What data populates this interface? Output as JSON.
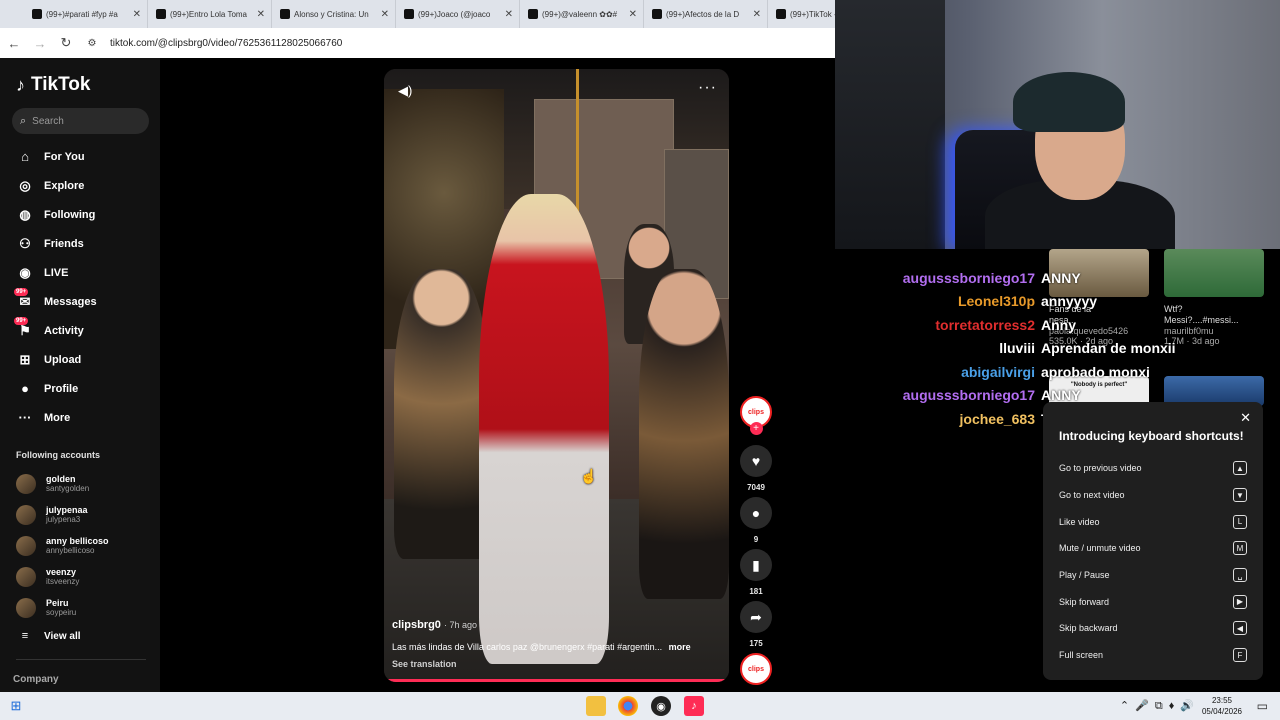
{
  "browser": {
    "tabs": [
      {
        "title": "(99+)#parati #fyp #a"
      },
      {
        "title": "(99+)Entro Lola Toma"
      },
      {
        "title": "Alonso y Cristina: Un"
      },
      {
        "title": "(99+)Joaco (@joaco"
      },
      {
        "title": "(99+)@valeenn ✿✿#"
      },
      {
        "title": "(99+)Afectos de la D"
      },
      {
        "title": "(99+)TikTok -"
      }
    ],
    "url": "tiktok.com/@clipsbrg0/video/7625361128025066760"
  },
  "sidebar": {
    "logo": "TikTok",
    "search_placeholder": "Search",
    "nav": [
      {
        "label": "For You",
        "icon": "home-icon"
      },
      {
        "label": "Explore",
        "icon": "compass-icon"
      },
      {
        "label": "Following",
        "icon": "following-icon"
      },
      {
        "label": "Friends",
        "icon": "friends-icon"
      },
      {
        "label": "LIVE",
        "icon": "live-icon"
      },
      {
        "label": "Messages",
        "icon": "messages-icon",
        "badge": "99+"
      },
      {
        "label": "Activity",
        "icon": "activity-icon",
        "badge": "99+"
      },
      {
        "label": "Upload",
        "icon": "upload-icon"
      },
      {
        "label": "Profile",
        "icon": "profile-icon"
      },
      {
        "label": "More",
        "icon": "more-icon"
      }
    ],
    "following_title": "Following accounts",
    "accounts": [
      {
        "name": "golden",
        "handle": "santygolden"
      },
      {
        "name": "julypenaa",
        "handle": "julypena3"
      },
      {
        "name": "anny bellicoso",
        "handle": "annybellicoso"
      },
      {
        "name": "veenzy",
        "handle": "itsveenzy"
      },
      {
        "name": "Peiru",
        "handle": "soypeiru"
      }
    ],
    "view_all": "View all",
    "company": "Company"
  },
  "video": {
    "author": "clipsbrg0",
    "time": "· 7h ago",
    "caption": "Las más lindas de Villa carlos paz @brunengerx #parati #argentin...",
    "more": "more",
    "see_translation": "See translation",
    "progress": 0.99
  },
  "actions": {
    "avatar_text": "clips",
    "likes": "7049",
    "comments": "9",
    "saves": "181",
    "shares": "175"
  },
  "chat": [
    {
      "user": "augusssborniego17",
      "msg": "ANNY",
      "color": "#b26ef0"
    },
    {
      "user": "Leonel310p",
      "msg": "annyyyy",
      "color": "#e89a2a"
    },
    {
      "user": "torretatorress2",
      "msg": "Anny",
      "color": "#e02e2e"
    },
    {
      "user": "lluviii",
      "msg": "Aprendan de monxii",
      "color": "#ffffff"
    },
    {
      "user": "abigailvirgi",
      "msg": "aprobado monxi",
      "color": "#4aa0e8"
    },
    {
      "user": "augusssborniego17",
      "msg": "ANNY",
      "color": "#b26ef0"
    },
    {
      "user": "jochee_683",
      "msg": "TE AMO MONXII",
      "color": "#f0c060"
    }
  ],
  "right_thumbs": [
    {
      "title": "Fans de la",
      "sub": "nesa..",
      "user": "paola.quevedo5426",
      "stats": "535.0K · 2d ago"
    },
    {
      "title": "Wtf?",
      "sub": "Messi?....#messi...",
      "user": "maurilbf0mu",
      "stats": "1.7M · 3d ago"
    },
    {
      "title": "\"Nobody is perfect\"",
      "sub": "",
      "user": "",
      "stats": ""
    },
    {
      "title": "",
      "sub": "",
      "user": "",
      "stats": ""
    }
  ],
  "shortcuts": {
    "title": "Introducing keyboard shortcuts!",
    "items": [
      {
        "label": "Go to previous video",
        "key": "▲"
      },
      {
        "label": "Go to next video",
        "key": "▼"
      },
      {
        "label": "Like video",
        "key": "L"
      },
      {
        "label": "Mute / unmute video",
        "key": "M"
      },
      {
        "label": "Play / Pause",
        "key": "␣"
      },
      {
        "label": "Skip forward",
        "key": "▶"
      },
      {
        "label": "Skip backward",
        "key": "◀"
      },
      {
        "label": "Full screen",
        "key": "F"
      }
    ]
  },
  "taskbar": {
    "time": "23:55",
    "date": "05/04/2026"
  }
}
